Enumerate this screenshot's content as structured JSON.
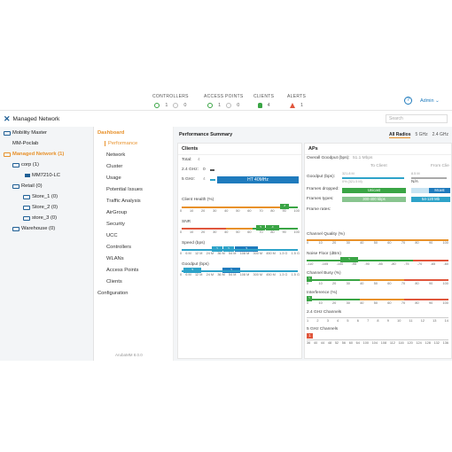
{
  "header": {
    "controllers": {
      "label": "CONTROLLERS",
      "ok": "1",
      "warn": "0"
    },
    "access_points": {
      "label": "ACCESS POINTS",
      "ok": "1",
      "warn": "0"
    },
    "clients": {
      "label": "CLIENTS",
      "value": "4"
    },
    "alerts": {
      "label": "ALERTS",
      "value": "1"
    },
    "help": "?",
    "user": "Admin ⌄"
  },
  "title": "Managed Network",
  "search_placeholder": "Search",
  "tree": {
    "items": [
      {
        "label": "Mobility Master"
      },
      {
        "label": "MM-Poclab"
      },
      {
        "label": "Managed Network (1)"
      },
      {
        "label": "corp (1)"
      },
      {
        "label": "MM7210-LC"
      },
      {
        "label": "Retail (0)"
      },
      {
        "label": "Store_1 (0)"
      },
      {
        "label": "Store_2 (0)"
      },
      {
        "label": "store_3 (0)"
      },
      {
        "label": "Warehouse (0)"
      }
    ]
  },
  "nav": {
    "dashboard": "Dashboard",
    "items": [
      "Performance",
      "Network",
      "Cluster",
      "Usage",
      "Potential Issues",
      "Traffic Analysis",
      "AirGroup",
      "Security",
      "UCC",
      "Controllers",
      "WLANs",
      "Access Points",
      "Clients"
    ],
    "configuration": "Configuration",
    "version": "ArubaMM 8.0.0"
  },
  "main": {
    "title": "Performance Summary",
    "tabs": [
      "All Radios",
      "5 GHz",
      "2.4 GHz"
    ],
    "clients": {
      "title": "Clients",
      "total": "Total:",
      "total_val": "4",
      "ghz24": "2.4 GHz:",
      "ghz24_val": "0",
      "ghz5": "5 GHz:",
      "ghz5_val": "4",
      "ht40": "HT 40MHz",
      "health": "Client Health (%)",
      "health_val": "4",
      "health_ticks": [
        "0",
        "10",
        "20",
        "30",
        "40",
        "50",
        "60",
        "70",
        "80",
        "90",
        "100"
      ],
      "snr": "SNR",
      "snr_vals": [
        "2",
        "4"
      ],
      "snr_ticks": [
        "0",
        "10",
        "20",
        "30",
        "40",
        "50",
        "60",
        "70",
        "80",
        "90",
        "100"
      ],
      "speed": "Speed (bps)",
      "speed_vals": [
        "1",
        "1",
        "2"
      ],
      "speed_ticks": [
        "0",
        "6 M",
        "12 M",
        "24 M",
        "36 M",
        "54 M",
        "108 M",
        "300 M",
        "450 M",
        "1.3 G",
        "1.5 G"
      ],
      "goodput": "Goodput (bps)",
      "goodput_vals": [
        "2",
        "1"
      ],
      "goodput_ticks": [
        "0",
        "6 M",
        "12 M",
        "24 M",
        "36 M",
        "54 M",
        "108 M",
        "300 M",
        "450 M",
        "1.3 G",
        "1.5 G"
      ]
    },
    "aps": {
      "title": "APs",
      "overall": "Overall Goodput (bps):",
      "overall_val": "51.1 Mbps",
      "to_client": "To Client",
      "from_client": "From Clie",
      "goodput": "Goodput (bps):",
      "gp_a": "321.8 M",
      "gp_b": "8.5 M",
      "gp_c": "0% (321.5 M)",
      "gp_d": "N/A",
      "dropped": "Frames dropped:",
      "unicast": "Unicast",
      "mcast": "Mcast",
      "types": "Frames types:",
      "t1": "300-400 kbps",
      "t2": "54-120 Mb",
      "rates": "Frame rates:",
      "quality": "Channel Quality (%)",
      "quality_ticks": [
        "0",
        "10",
        "20",
        "30",
        "40",
        "50",
        "60",
        "70",
        "80",
        "90",
        "100"
      ],
      "noise": "Noise Floor (dBm)",
      "noise_val": "1",
      "noise_ticks": [
        "-110",
        "-105",
        "-100",
        "-95",
        "-90",
        "-85",
        "-80",
        "-75",
        "-70",
        "-65",
        "-60"
      ],
      "busy": "Channel Busy (%)",
      "busy_val": "1",
      "busy_ticks": [
        "0",
        "10",
        "20",
        "30",
        "40",
        "50",
        "60",
        "70",
        "80",
        "90",
        "100"
      ],
      "interf": "Interference (%)",
      "interf_val": "1",
      "interf_ticks": [
        "0",
        "10",
        "20",
        "30",
        "40",
        "50",
        "60",
        "70",
        "80",
        "90",
        "100"
      ],
      "ch24": "2.4 GHz Channels",
      "ch24_ticks": [
        "1",
        "2",
        "3",
        "4",
        "5",
        "6",
        "7",
        "8",
        "9",
        "10",
        "11",
        "12",
        "13",
        "14"
      ],
      "ch5": "5 GHz Channels",
      "ch5_val": "1",
      "ch5_ticks": [
        "36",
        "40",
        "44",
        "48",
        "52",
        "56",
        "60",
        "64",
        "100",
        "104",
        "108",
        "112",
        "116",
        "120",
        "124",
        "128",
        "132",
        "136"
      ]
    }
  },
  "colors": {
    "accent": "#e8912a",
    "blue": "#1f7bbd",
    "green": "#3aa545",
    "red": "#e0563c",
    "teal": "#2ea3c9"
  }
}
